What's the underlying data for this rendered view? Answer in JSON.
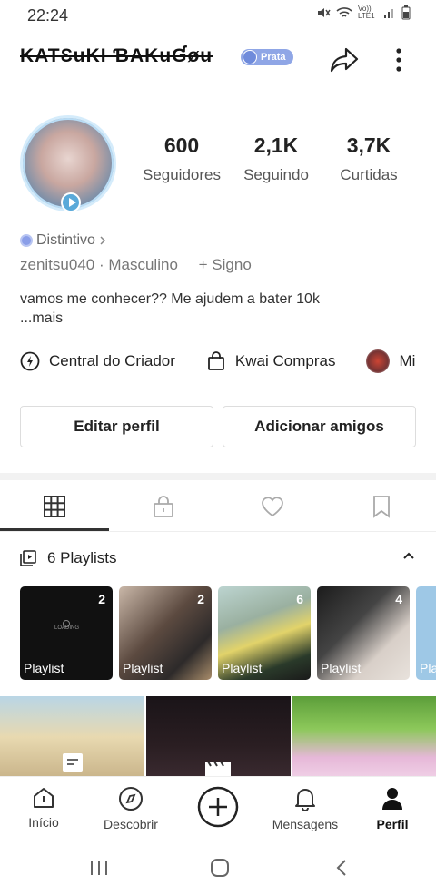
{
  "status_bar": {
    "time": "22:24",
    "network": "Vo)) LTE1"
  },
  "profile": {
    "username": "KATƐuKI ƁAKuƓøu",
    "badge": "Prata",
    "stats": [
      {
        "value": "600",
        "label": "Seguidores"
      },
      {
        "value": "2,1K",
        "label": "Seguindo"
      },
      {
        "value": "3,7K",
        "label": "Curtidas"
      }
    ],
    "distintivo": "Distintivo",
    "handle": "zenitsu040",
    "gender": "Masculino",
    "sign": "+ Signo",
    "bio_line1": "vamos me conhecer?? Me ajudem a bater 10k",
    "bio_more": "...mais"
  },
  "tools": [
    {
      "label": "Central do Criador",
      "icon": "lightning-circle-icon"
    },
    {
      "label": "Kwai Compras",
      "icon": "shopping-bag-icon"
    },
    {
      "label": "Mi",
      "icon": "avatar-icon"
    }
  ],
  "buttons": {
    "edit": "Editar perfil",
    "add": "Adicionar amigos"
  },
  "playlists": {
    "header": "6 Playlists",
    "items": [
      {
        "count": "2",
        "title": "Playlist",
        "overlay": "LOADING",
        "color": "#111111"
      },
      {
        "count": "2",
        "title": "Playlist",
        "color": "#6b5a55"
      },
      {
        "count": "6",
        "title": "Playlist",
        "color": "#8aa8b8"
      },
      {
        "count": "4",
        "title": "Playlist",
        "color": "#3a3a3a"
      },
      {
        "count": "",
        "title": "Pla",
        "color": "#9ec8e6"
      }
    ]
  },
  "bottom_nav": [
    {
      "label": "Início",
      "icon": "home-icon"
    },
    {
      "label": "Descobrir",
      "icon": "compass-icon"
    },
    {
      "label": "",
      "icon": "plus-circle-icon"
    },
    {
      "label": "Mensagens",
      "icon": "bell-icon"
    },
    {
      "label": "Perfil",
      "icon": "person-icon",
      "active": true
    }
  ]
}
